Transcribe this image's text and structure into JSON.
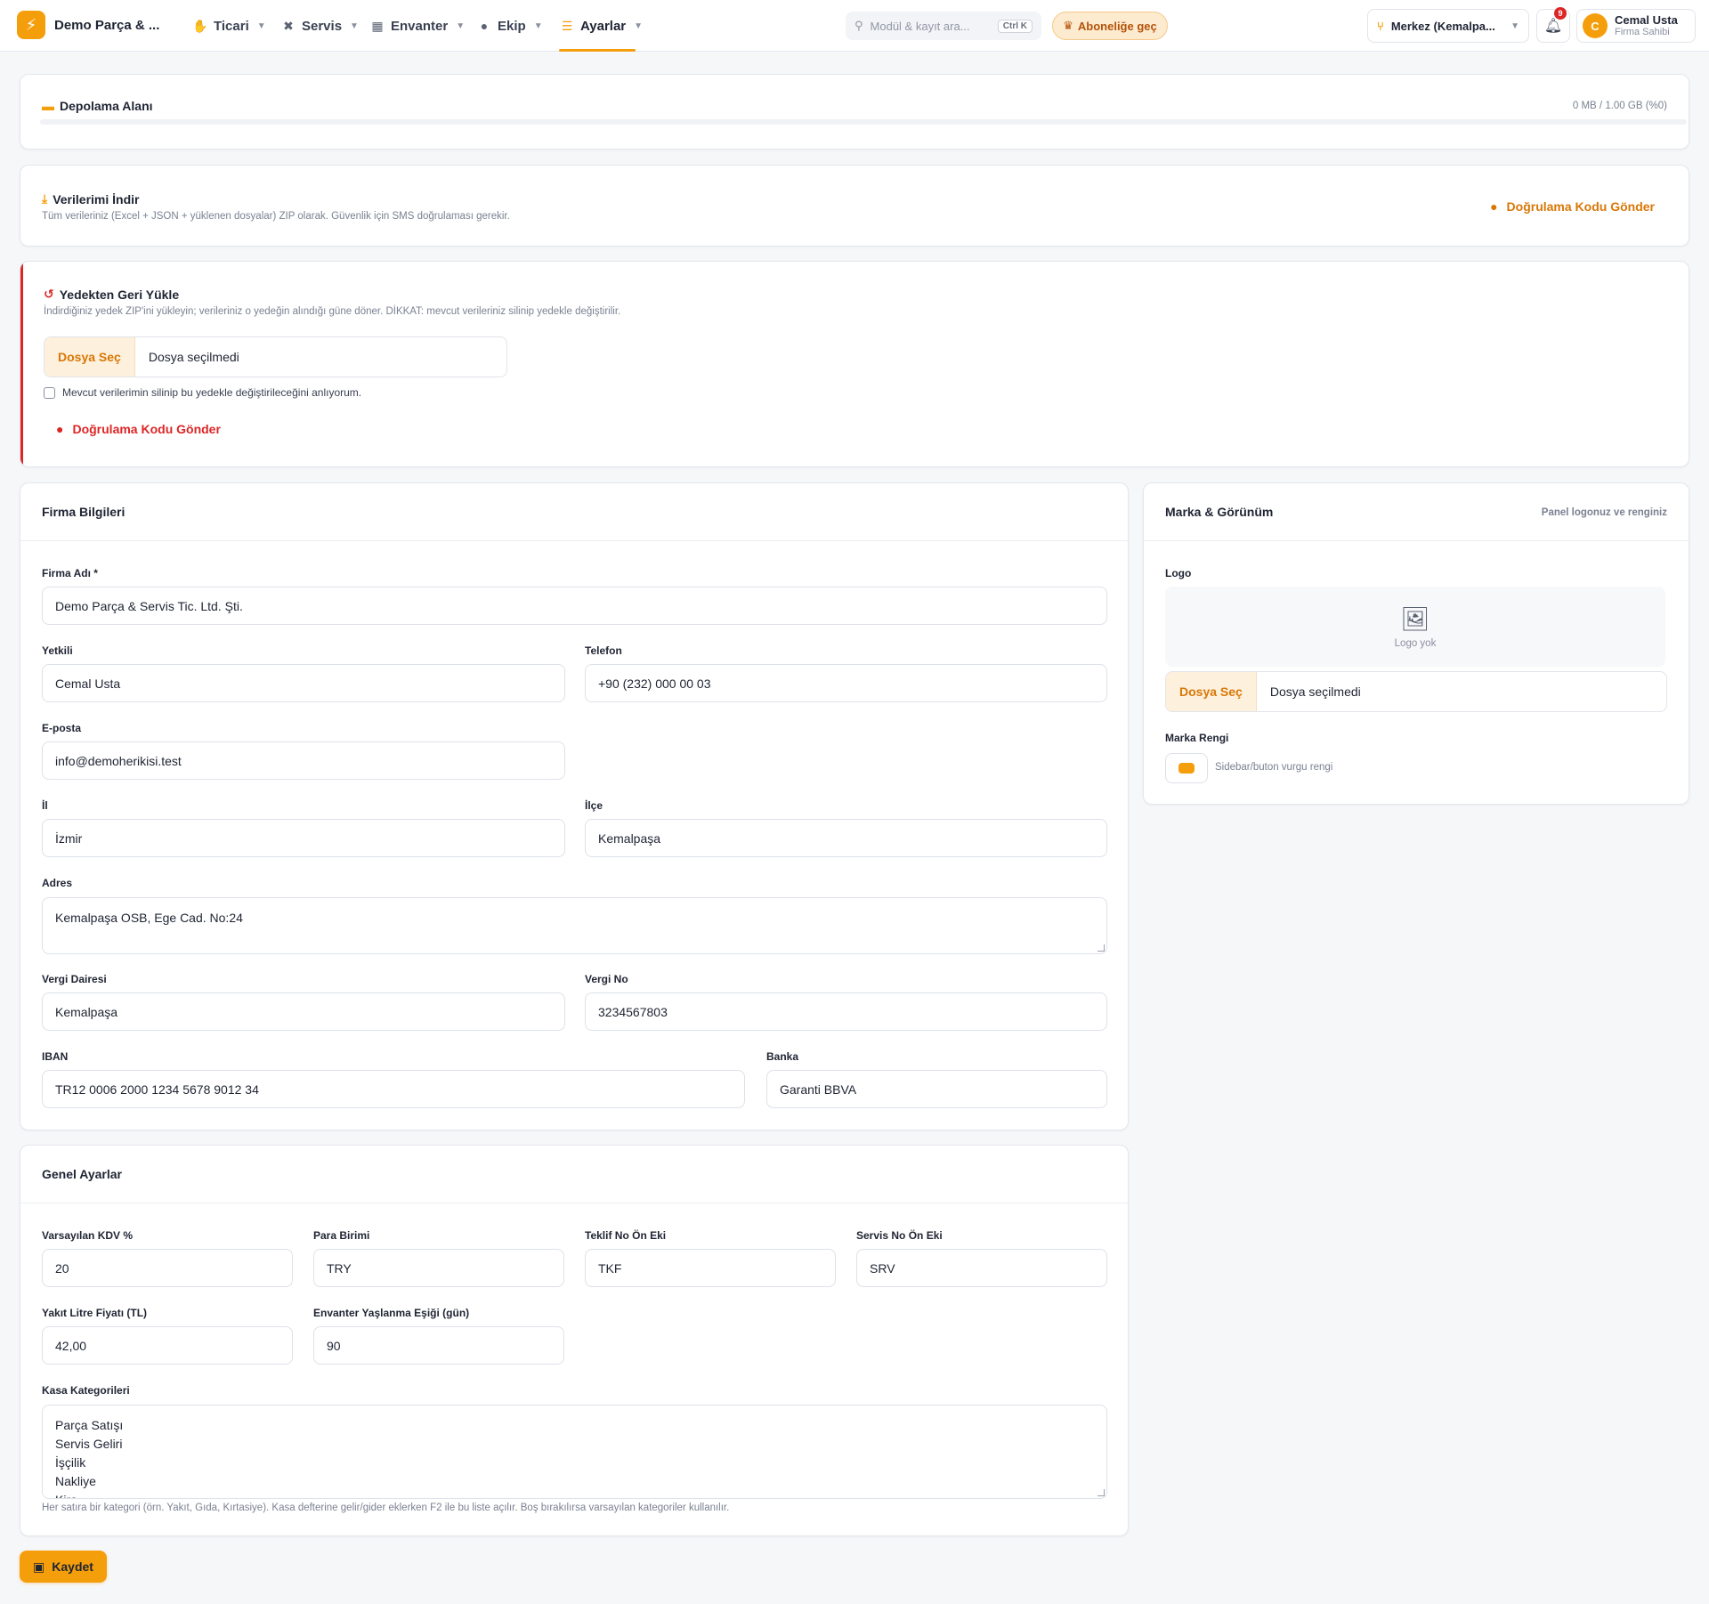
{
  "header": {
    "brand_name": "Demo Parça & ...",
    "nav": [
      {
        "label": "Ticari",
        "icon": "handshake-icon"
      },
      {
        "label": "Servis",
        "icon": "tools-icon"
      },
      {
        "label": "Envanter",
        "icon": "warehouse-icon"
      },
      {
        "label": "Ekip",
        "icon": "team-icon"
      },
      {
        "label": "Ayarlar",
        "icon": "sliders-icon",
        "active": true
      }
    ],
    "search_placeholder": "Modül & kayıt ara...",
    "search_shortcut": "Ctrl K",
    "subscribe_label": "Aboneliğe geç",
    "branch_label": "Merkez (Kemalpa...",
    "notification_count": "9",
    "user_initial": "C",
    "user_name": "Cemal Usta",
    "user_role": "Firma Sahibi"
  },
  "storage": {
    "title": "Depolama Alanı",
    "usage_text": "0 MB / 1.00 GB  (%0)",
    "usage_fraction": 0
  },
  "download": {
    "title": "Verilerimi İndir",
    "description": "Tüm verileriniz (Excel + JSON + yüklenen dosyalar) ZIP olarak. Güvenlik için SMS doğrulaması gerekir.",
    "button_label": "Doğrulama Kodu Gönder"
  },
  "restore": {
    "title": "Yedekten Geri Yükle",
    "description": "İndirdiğiniz yedek ZIP'ini yükleyin; verileriniz o yedeğin alındığı güne döner. DİKKAT: mevcut verileriniz silinip yedekle değiştirilir.",
    "file_button": "Dosya Seç",
    "file_status": "Dosya seçilmedi",
    "confirm_label": "Mevcut verilerimin silinip bu yedekle değiştirileceğini anlıyorum.",
    "button_label": "Doğrulama Kodu Gönder"
  },
  "company": {
    "title": "Firma Bilgileri",
    "name_label": "Firma Adı *",
    "name_value": "Demo Parça & Servis Tic. Ltd. Şti.",
    "contact_label": "Yetkili",
    "contact_value": "Cemal Usta",
    "phone_label": "Telefon",
    "phone_value": "+90 (232) 000 00 03",
    "email_label": "E-posta",
    "email_value": "info@demoherikisi.test",
    "city_label": "İl",
    "city_value": "İzmir",
    "district_label": "İlçe",
    "district_value": "Kemalpaşa",
    "address_label": "Adres",
    "address_value": "Kemalpaşa OSB, Ege Cad. No:24",
    "tax_office_label": "Vergi Dairesi",
    "tax_office_value": "Kemalpaşa",
    "tax_no_label": "Vergi No",
    "tax_no_value": "3234567803",
    "iban_label": "IBAN",
    "iban_value": "TR12 0006 2000 1234 5678 9012 34",
    "bank_label": "Banka",
    "bank_value": "Garanti BBVA"
  },
  "brand": {
    "title": "Marka & Görünüm",
    "subtitle": "Panel logonuz ve renginiz",
    "logo_label": "Logo",
    "logo_empty": "Logo yok",
    "file_button": "Dosya Seç",
    "file_status": "Dosya seçilmedi",
    "color_label": "Marka Rengi",
    "color_hint": "Sidebar/buton vurgu rengi",
    "color_value": "#f59e0b"
  },
  "general": {
    "title": "Genel Ayarlar",
    "vat_label": "Varsayılan KDV %",
    "vat_value": "20",
    "currency_label": "Para Birimi",
    "currency_value": "TRY",
    "quote_prefix_label": "Teklif No Ön Eki",
    "quote_prefix_value": "TKF",
    "service_prefix_label": "Servis No Ön Eki",
    "service_prefix_value": "SRV",
    "fuel_label": "Yakıt Litre Fiyatı (TL)",
    "fuel_value": "42,00",
    "aging_label": "Envanter Yaşlanma Eşiği (gün)",
    "aging_value": "90",
    "categories_label": "Kasa Kategorileri",
    "categories": [
      "Parça Satışı",
      "Servis Geliri",
      "İşçilik",
      "Nakliye",
      "Kira"
    ],
    "categories_hint": "Her satıra bir kategori (örn. Yakıt, Gıda, Kırtasiye). Kasa defterine gelir/gider eklerken F2 ile bu liste açılır. Boş bırakılırsa varsayılan kategoriler kullanılır."
  },
  "save_label": "Kaydet",
  "colors": {
    "accent": "#f59e0b",
    "danger": "#dc2626"
  }
}
